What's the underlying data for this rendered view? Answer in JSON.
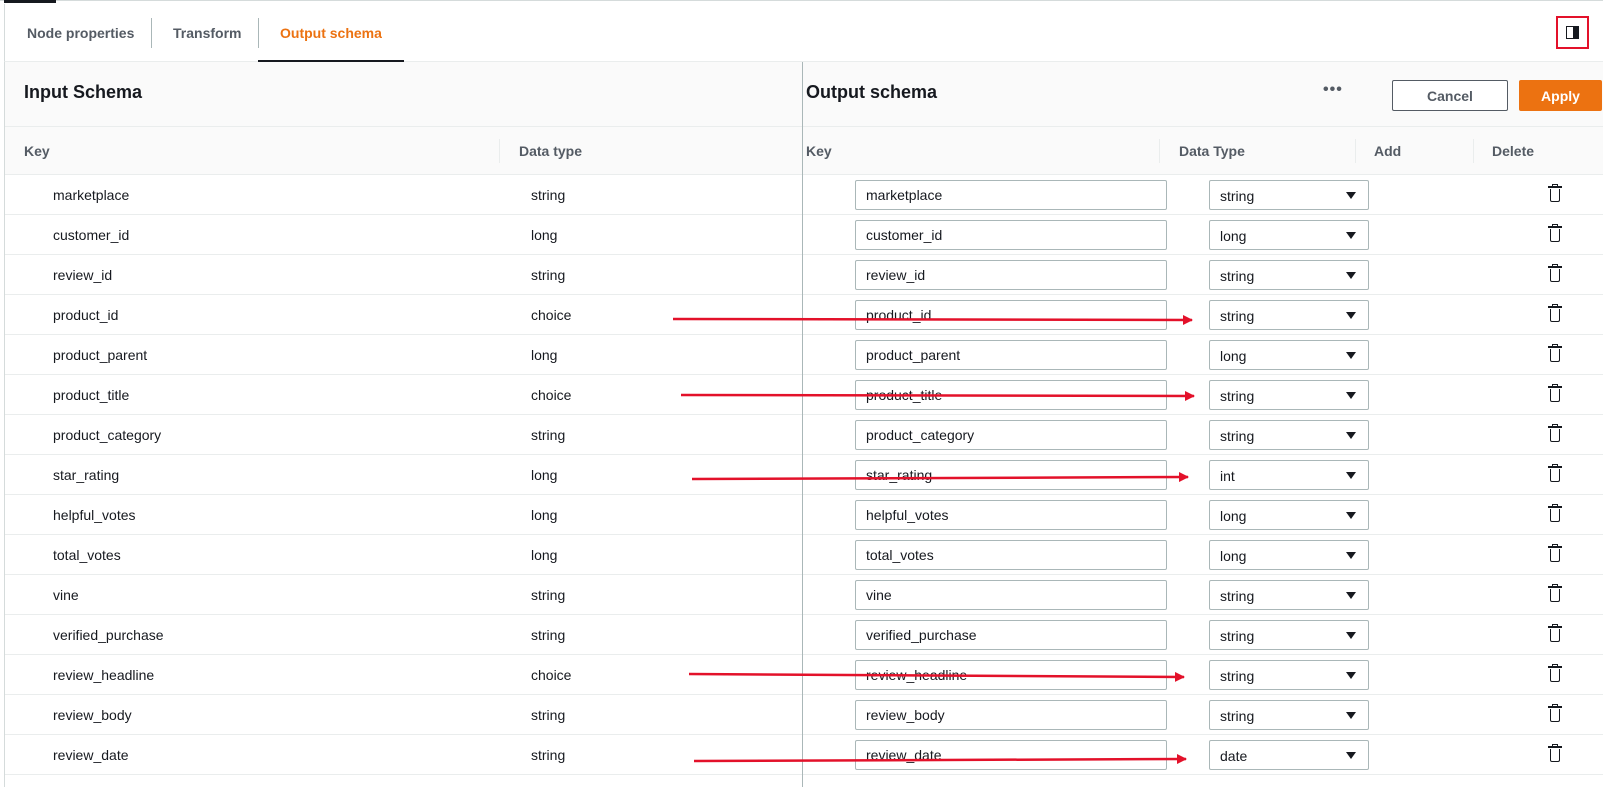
{
  "tabs": [
    {
      "label": "Node properties",
      "active": false
    },
    {
      "label": "Transform",
      "active": false
    },
    {
      "label": "Output schema",
      "active": true
    }
  ],
  "panel_toggle_icon": "panel-split-icon",
  "input_schema": {
    "title": "Input Schema",
    "columns": {
      "key": "Key",
      "type": "Data type"
    },
    "rows": [
      {
        "key": "marketplace",
        "type": "string"
      },
      {
        "key": "customer_id",
        "type": "long"
      },
      {
        "key": "review_id",
        "type": "string"
      },
      {
        "key": "product_id",
        "type": "choice"
      },
      {
        "key": "product_parent",
        "type": "long"
      },
      {
        "key": "product_title",
        "type": "choice"
      },
      {
        "key": "product_category",
        "type": "string"
      },
      {
        "key": "star_rating",
        "type": "long"
      },
      {
        "key": "helpful_votes",
        "type": "long"
      },
      {
        "key": "total_votes",
        "type": "long"
      },
      {
        "key": "vine",
        "type": "string"
      },
      {
        "key": "verified_purchase",
        "type": "string"
      },
      {
        "key": "review_headline",
        "type": "choice"
      },
      {
        "key": "review_body",
        "type": "string"
      },
      {
        "key": "review_date",
        "type": "string"
      }
    ]
  },
  "output_schema": {
    "title": "Output schema",
    "more_icon": "ellipsis-icon",
    "cancel_label": "Cancel",
    "apply_label": "Apply",
    "columns": {
      "key": "Key",
      "type": "Data Type",
      "add": "Add",
      "delete": "Delete"
    },
    "rows": [
      {
        "key": "marketplace",
        "type": "string"
      },
      {
        "key": "customer_id",
        "type": "long"
      },
      {
        "key": "review_id",
        "type": "string"
      },
      {
        "key": "product_id",
        "type": "string"
      },
      {
        "key": "product_parent",
        "type": "long"
      },
      {
        "key": "product_title",
        "type": "string"
      },
      {
        "key": "product_category",
        "type": "string"
      },
      {
        "key": "star_rating",
        "type": "int"
      },
      {
        "key": "helpful_votes",
        "type": "long"
      },
      {
        "key": "total_votes",
        "type": "long"
      },
      {
        "key": "vine",
        "type": "string"
      },
      {
        "key": "verified_purchase",
        "type": "string"
      },
      {
        "key": "review_headline",
        "type": "string"
      },
      {
        "key": "review_body",
        "type": "string"
      },
      {
        "key": "review_date",
        "type": "date"
      }
    ]
  },
  "annotation_color": "#e3112a"
}
